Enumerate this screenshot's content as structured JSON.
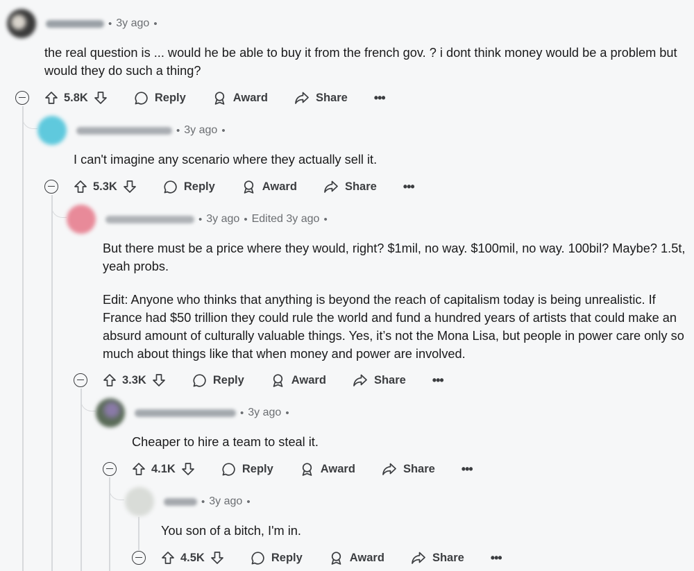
{
  "comments": [
    {
      "time": "3y ago",
      "edited": "",
      "paragraphs": [
        "the real question is ... would he be able to buy it from the french gov. ? i dont think money would be a problem but would they do such a thing?"
      ],
      "votes": "5.8K",
      "avatar_color": "#3a3a3a"
    },
    {
      "time": "3y ago",
      "edited": "",
      "paragraphs": [
        "I can't imagine any scenario where they actually sell it."
      ],
      "votes": "5.3K",
      "avatar_color": "#5fc9dd"
    },
    {
      "time": "3y ago",
      "edited": "Edited 3y ago",
      "paragraphs": [
        "But there must be a price where they would, right? $1mil, no way. $100mil, no way. 100bil? Maybe? 1.5t, yeah probs.",
        "Edit: Anyone who thinks that anything is beyond the reach of capitalism today is being unrealistic. If France had $50 trillion they could rule the world and fund a hundred years of artists that could make an absurd amount of culturally valuable things. Yes, it’s not the Mona Lisa, but people in power care only so much about things like that when money and power are involved."
      ],
      "votes": "3.3K",
      "avatar_color": "#e88a99"
    },
    {
      "time": "3y ago",
      "edited": "",
      "paragraphs": [
        "Cheaper to hire a team to steal it."
      ],
      "votes": "4.1K",
      "avatar_color": "#5a6b58"
    },
    {
      "time": "3y ago",
      "edited": "",
      "paragraphs": [
        "You son of a bitch, I'm in."
      ],
      "votes": "4.5K",
      "avatar_color": "#d9dcd8"
    }
  ],
  "actions": {
    "reply": "Reply",
    "award": "Award",
    "share": "Share",
    "more": "•••"
  },
  "meta_dot": "•",
  "icons": {
    "collapse": "minus-circle-icon",
    "upvote": "arrow-up-icon",
    "downvote": "arrow-down-icon",
    "reply": "speech-bubble-icon",
    "award": "award-ribbon-icon",
    "share": "share-arrow-icon",
    "more": "ellipsis-icon"
  }
}
